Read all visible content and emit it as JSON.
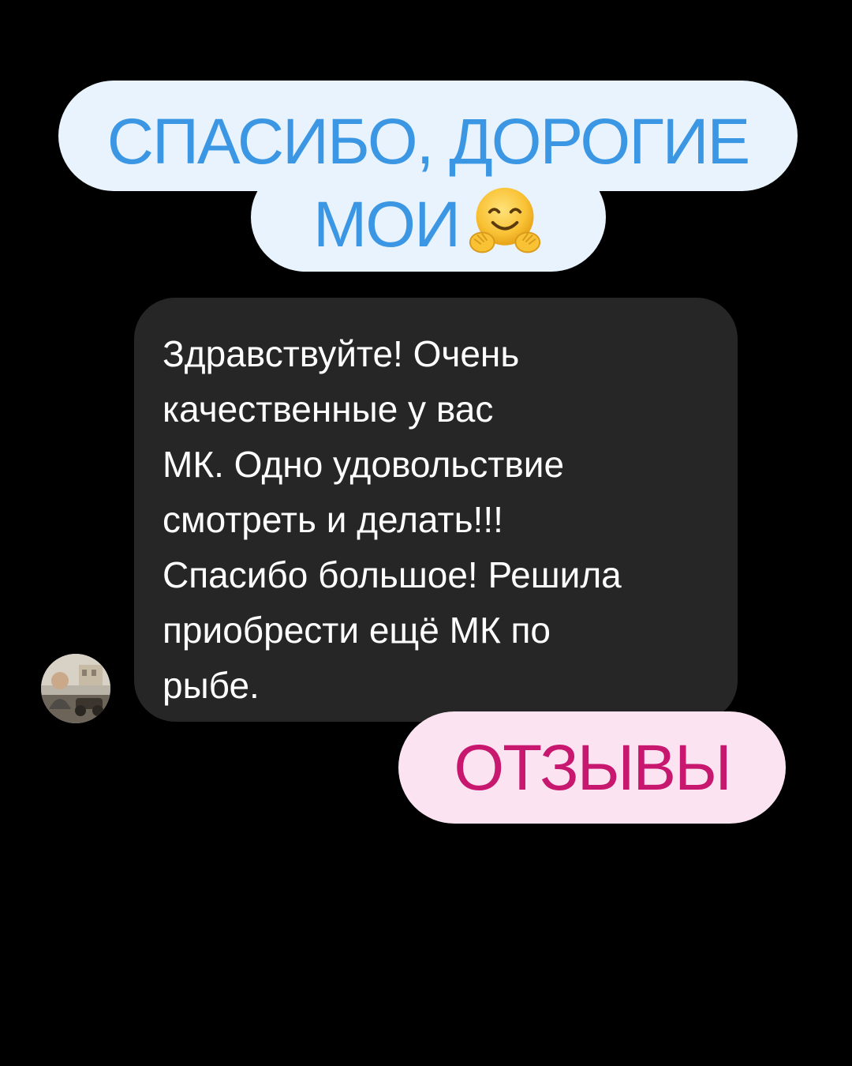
{
  "header_sticker": {
    "line1": "СПАСИБО, ДОРОГИЕ",
    "line2": "МОИ",
    "emoji_icon": "hugging-face-icon",
    "text_color": "#3b97e3",
    "background_color": "#e8f3fd"
  },
  "message": {
    "text": "Здравствуйте! Очень\nкачественные у вас\nМК. Одно удовольствие\nсмотреть и делать!!!\nСпасибо большое! Решила\nприобрести ещё МК по\nрыбе.",
    "bubble_color": "#262626",
    "text_color": "#ffffff",
    "avatar_icon": "user-avatar-icon"
  },
  "reviews_sticker": {
    "label": "ОТЗЫВЫ",
    "text_color": "#c8176e",
    "background_color": "#fce3f1"
  },
  "background_color": "#000000"
}
